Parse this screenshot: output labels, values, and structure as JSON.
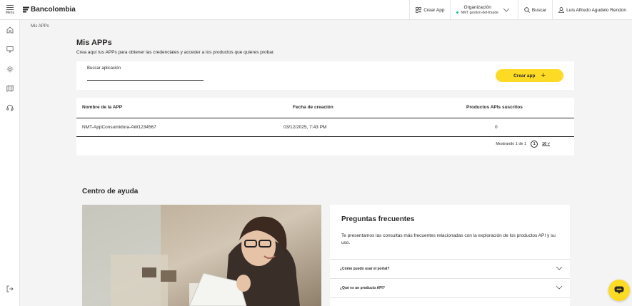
{
  "topbar": {
    "menu_label": "Menú",
    "brand": "Bancolombia",
    "create_app": "Crear App",
    "org_label": "Organización",
    "org_name": "NMT gestion-del-fraude",
    "search": "Buscar",
    "user_name": "Luis Alfredo Agudelo Rendon"
  },
  "sidebar": {
    "icons": [
      "home-icon",
      "monitor-icon",
      "settings-icon",
      "map-icon",
      "headset-icon",
      "logout-icon"
    ]
  },
  "breadcrumb": "Mis APPs",
  "page": {
    "title": "Mis APPs",
    "subtitle": "Crea aquí tus APPs para obtener las credenciales y acceder a los productos que quieres probar."
  },
  "search": {
    "label": "Buscar aplicación",
    "value": "",
    "create_button": "Crear app"
  },
  "table": {
    "headers": [
      "Nombre de la APP",
      "Fecha de creación",
      "Productos APIs suscritos"
    ],
    "rows": [
      [
        "NMT-AppConsumidora-AW1234567",
        "03/12/2025, 7:43 PM",
        "0"
      ]
    ],
    "pagination": {
      "showing": "Mostrando 1 de 1",
      "current_page": "1",
      "page_size": "10"
    }
  },
  "help": {
    "title": "Centro de ayuda",
    "faq_title": "Preguntas frecuentes",
    "faq_desc": "Te presentamos las consultas más frecuentes relacionadas con la exploración de los productos API y su uso.",
    "questions": [
      "¿Cómo puedo usar el portal?",
      "¿Qué es un producto API?"
    ]
  },
  "colors": {
    "accent": "#fdda24",
    "text": "#2c2a29",
    "background": "#f4f4f4"
  }
}
